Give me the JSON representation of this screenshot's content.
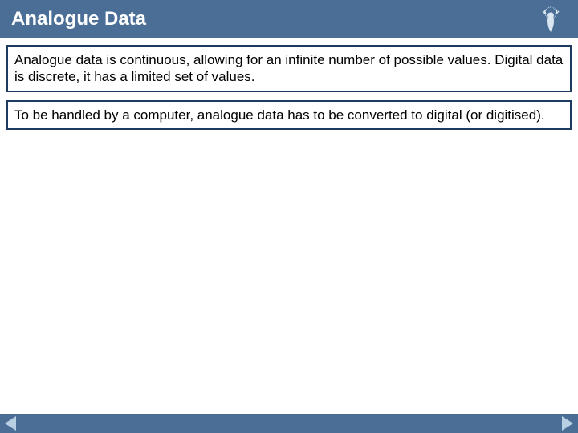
{
  "header": {
    "title": "Analogue Data"
  },
  "content": {
    "boxes": [
      "Analogue data is continuous, allowing for an infinite number of possible values. Digital data is discrete, it has a limited set of values.",
      "To be handled by a computer, analogue data has to be converted to digital (or digitised)."
    ]
  },
  "colors": {
    "header_bg": "#4a6e96",
    "border": "#1f3a5f",
    "arrow": "#b9cfe4"
  }
}
